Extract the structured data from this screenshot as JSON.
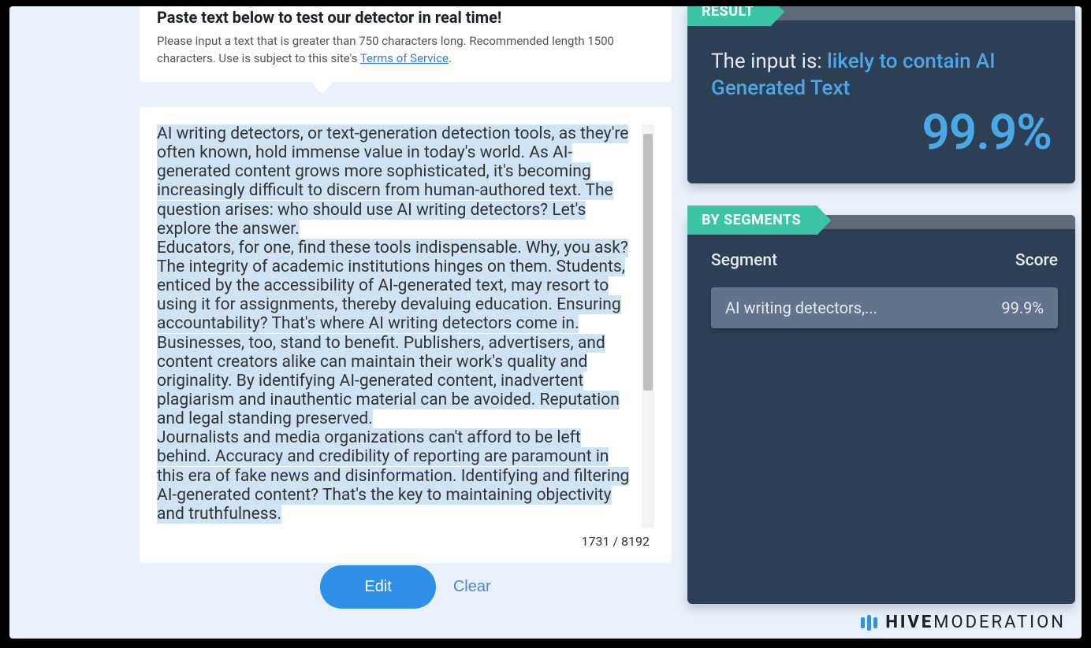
{
  "instructions": {
    "title": "Paste text below to test our detector in real time!",
    "body_before_link": "Please input a text that is greater than 750 characters long. Recommended length 1500 characters. Use is subject to this site's ",
    "tos_link": "Terms of Service",
    "body_after_link": "."
  },
  "input": {
    "text_p1": "AI writing detectors, or text-generation detection tools, as they're often known, hold immense value in today's world. As AI-generated content grows more sophisticated, it's becoming increasingly difficult to discern from human-authored text. The question arises: who should use AI writing detectors? Let's explore the answer.",
    "text_p2": "Educators, for one, find these tools indispensable. Why, you ask? The integrity of academic institutions hinges on them. Students, enticed by the accessibility of AI-generated text, may resort to using it for assignments, thereby devaluing education. Ensuring accountability? That's where AI writing detectors come in.",
    "text_p3": "Businesses, too, stand to benefit. Publishers, advertisers, and content creators alike can maintain their work's quality and originality. By identifying AI-generated content, inadvertent plagiarism and inauthentic material can be avoided. Reputation and legal standing preserved.",
    "text_p4": "Journalists and media organizations can't afford to be left behind. Accuracy and credibility of reporting are paramount in this era of fake news and disinformation. Identifying and filtering AI-generated content? That's the key to maintaining objectivity and truthfulness.",
    "char_count": "1731 / 8192"
  },
  "buttons": {
    "edit": "Edit",
    "clear": "Clear"
  },
  "result": {
    "tab": "RESULT",
    "prefix": "The input is: ",
    "verdict": "likely to contain AI Generated Text",
    "percent": "99.9%"
  },
  "segments": {
    "tab": "BY SEGMENTS",
    "header_segment": "Segment",
    "header_score": "Score",
    "rows": [
      {
        "label": "AI writing detectors,...",
        "score": "99.9%"
      }
    ]
  },
  "brand": {
    "bold": "HIVE",
    "thin": "MODERATION"
  }
}
